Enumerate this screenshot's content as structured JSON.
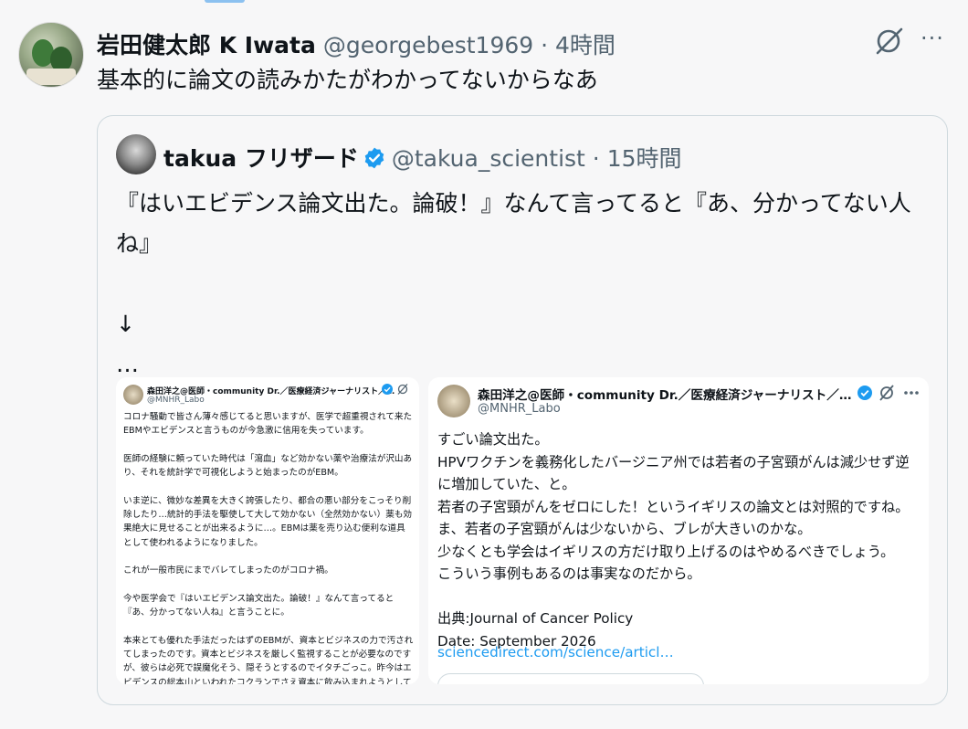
{
  "tweet": {
    "author_name": "岩田健太郎 K Iwata",
    "handle": "@georgebest1969",
    "time": "· 4時間",
    "text": "基本的に論文の読みかたがわかってないからなあ",
    "more": "···"
  },
  "quote": {
    "author_name": "takua フリザード",
    "handle": "@takua_scientist",
    "time": "· 15時間",
    "text": "『はいエビデンス論文出た。論破！』なんて言ってると『あ、分かってない人ね』\n\n↓\n…"
  },
  "image_left": {
    "author_name": "森田洋之@医師・community Dr.／医療経済ジャーナリスト／…",
    "handle": "@MNHR_Labo",
    "body": "コロナ騒動で皆さん薄々感じてると思いますが、医学で超重視されて来たEBMやエビデンスと言うものが今急激に信用を失っています。\n\n医師の経験に頼っていた時代は「瀉血」など効かない薬や治療法が沢山あり、それを統計学で可視化しようと始まったのがEBM。\n\nいま逆に、微妙な差異を大きく誇張したり、都合の悪い部分をこっそり削除したり…統計的手法を駆使して大して効かない（全然効かない）薬も効果絶大に見せることが出来るように…。EBMは薬を売り込む便利な道具として使われるようになりました。\n\nこれが一般市民にまでバレてしまったのがコロナ禍。\n\n今や医学会で『はいエビデンス論文出た。論破！』なんて言ってると『あ、分かってない人ね』と言うことに。\n\n本来とても優れた手法だったはずのEBMが、資本とビジネスの力で汚されてしまったのです。資本とビジネスを厳しく監視することが必要なのですが、彼らは必死で誤魔化そう、隠そうとするのでイタチごっこ。昨今はエビデンスの総本山といわれたコクランでさえ資本に飲み込まれようとしています。"
  },
  "image_right": {
    "author_name": "森田洋之@医師・community Dr.／医療経済ジャーナリスト／…",
    "handle": "@MNHR_Labo",
    "more": "···",
    "body": "すごい論文出た。\nHPVワクチンを義務化したバージニア州では若者の子宮頸がんは減少せず逆に増加していた、と。\n若者の子宮頸がんをゼロにした！というイギリスの論文とは対照的ですね。ま、若者の子宮頸がんは少ないから、ブレが大きいのかな。\n少なくとも学会はイギリスの方だけ取り上げるのはやめるべきでしょう。\nこういう事例もあるのは事実なのだから。\n\n出典:Journal of Cancer Policy\nDate: September 2026",
    "link": "sciencedirect.com/science/articl…"
  },
  "colors": {
    "accent": "#1d9bf0",
    "muted": "#536471",
    "border": "#cfd9de",
    "background": "#f7f7f8"
  },
  "icons": [
    "grok-icon",
    "more-icon",
    "verified-badge-icon"
  ]
}
